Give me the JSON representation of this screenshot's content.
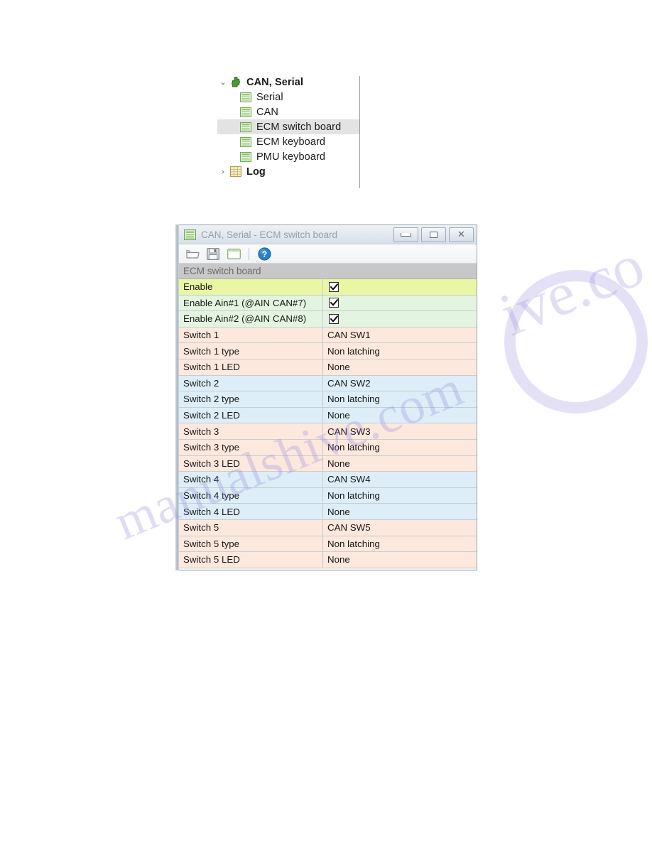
{
  "tree": {
    "items": [
      {
        "label": "CAN, Serial",
        "icon": "puzzle-piece-icon",
        "chevron": "⌄",
        "depth": 0,
        "bold": true,
        "selected": false
      },
      {
        "label": "Serial",
        "icon": "grid-list-icon",
        "chevron": "",
        "depth": 1,
        "bold": false,
        "selected": false
      },
      {
        "label": "CAN",
        "icon": "grid-list-icon",
        "chevron": "",
        "depth": 1,
        "bold": false,
        "selected": false
      },
      {
        "label": "ECM switch board",
        "icon": "grid-list-icon",
        "chevron": "",
        "depth": 1,
        "bold": false,
        "selected": true
      },
      {
        "label": "ECM keyboard",
        "icon": "grid-list-icon",
        "chevron": "",
        "depth": 1,
        "bold": false,
        "selected": false
      },
      {
        "label": "PMU keyboard",
        "icon": "grid-list-icon",
        "chevron": "",
        "depth": 1,
        "bold": false,
        "selected": false
      },
      {
        "label": "Log",
        "icon": "log-table-icon",
        "chevron": "›",
        "depth": 0,
        "bold": true,
        "selected": false
      }
    ]
  },
  "window": {
    "title": "CAN, Serial - ECM switch board",
    "title_icon": "grid-list-icon",
    "buttons": {
      "minimize": "minimize-icon",
      "maximize": "restore-icon",
      "close": "✕"
    },
    "toolbar": {
      "items": [
        {
          "name": "open-folder-icon",
          "label": "Open"
        },
        {
          "name": "save-disk-icon",
          "label": "Save"
        },
        {
          "name": "window-panel-icon",
          "label": "Window"
        },
        {
          "name": "separator",
          "label": ""
        },
        {
          "name": "help-icon",
          "label": "Help"
        }
      ]
    },
    "grid": {
      "header": "ECM switch board",
      "rows": [
        {
          "name": "Enable",
          "value": "",
          "type": "checkbox",
          "checked": true,
          "tint": "t-lime"
        },
        {
          "name": "Enable Ain#1 (@AIN CAN#7)",
          "value": "",
          "type": "checkbox",
          "checked": true,
          "tint": "t-mint"
        },
        {
          "name": "Enable Ain#2 (@AIN CAN#8)",
          "value": "",
          "type": "checkbox",
          "checked": true,
          "tint": "t-mint"
        },
        {
          "name": "Switch 1",
          "value": "CAN SW1",
          "type": "text",
          "checked": false,
          "tint": "t-peach"
        },
        {
          "name": "Switch 1 type",
          "value": "Non latching",
          "type": "text",
          "checked": false,
          "tint": "t-peach"
        },
        {
          "name": "Switch 1 LED",
          "value": "None",
          "type": "text",
          "checked": false,
          "tint": "t-peach"
        },
        {
          "name": "Switch 2",
          "value": "CAN SW2",
          "type": "text",
          "checked": false,
          "tint": "t-blue"
        },
        {
          "name": "Switch 2 type",
          "value": "Non latching",
          "type": "text",
          "checked": false,
          "tint": "t-blue"
        },
        {
          "name": "Switch 2 LED",
          "value": "None",
          "type": "text",
          "checked": false,
          "tint": "t-blue"
        },
        {
          "name": "Switch 3",
          "value": "CAN SW3",
          "type": "text",
          "checked": false,
          "tint": "t-peach"
        },
        {
          "name": "Switch 3 type",
          "value": "Non latching",
          "type": "text",
          "checked": false,
          "tint": "t-peach"
        },
        {
          "name": "Switch 3 LED",
          "value": "None",
          "type": "text",
          "checked": false,
          "tint": "t-peach"
        },
        {
          "name": "Switch 4",
          "value": "CAN SW4",
          "type": "text",
          "checked": false,
          "tint": "t-blue"
        },
        {
          "name": "Switch 4 type",
          "value": "Non latching",
          "type": "text",
          "checked": false,
          "tint": "t-blue"
        },
        {
          "name": "Switch 4 LED",
          "value": "None",
          "type": "text",
          "checked": false,
          "tint": "t-blue"
        },
        {
          "name": "Switch 5",
          "value": "CAN SW5",
          "type": "text",
          "checked": false,
          "tint": "t-peach"
        },
        {
          "name": "Switch 5 type",
          "value": "Non latching",
          "type": "text",
          "checked": false,
          "tint": "t-peach"
        },
        {
          "name": "Switch 5 LED",
          "value": "None",
          "type": "text",
          "checked": false,
          "tint": "t-peach"
        }
      ]
    }
  },
  "watermark": {
    "line1": "manualshive.com",
    "line2": "ive.co"
  },
  "colors": {
    "row_lime": "#e9f6a4",
    "row_mint": "#e3f5e0",
    "row_peach": "#fce8dd",
    "row_blue": "#ddeef8",
    "header_gray": "#c8c8c8",
    "selection_gray": "#e3e3e3",
    "icon_green": "#6aa84f",
    "help_blue": "#2a7fc9"
  }
}
